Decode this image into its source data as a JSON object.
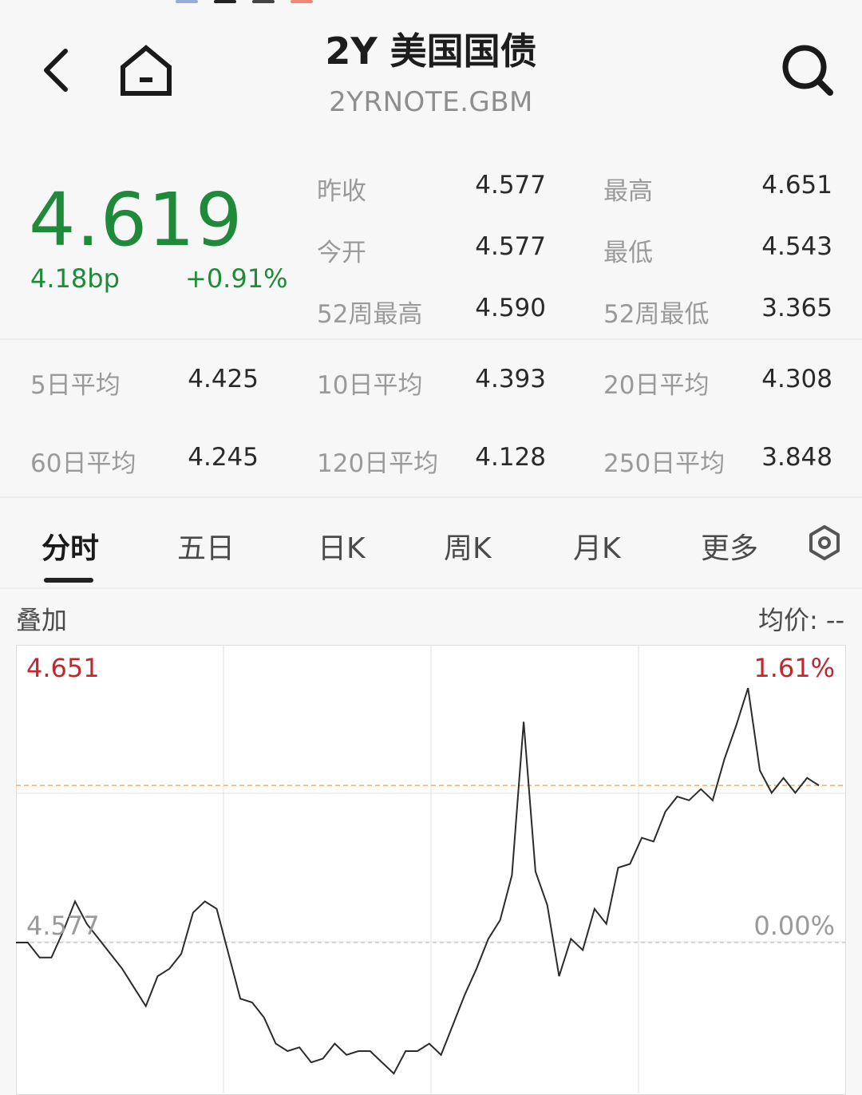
{
  "header": {
    "title": "2Y 美国国债",
    "subtitle": "2YRNOTE.GBM"
  },
  "quote": {
    "price": "4.619",
    "change_bp": "4.18bp",
    "change_pct": "+0.91%",
    "stats": [
      {
        "label": "昨收",
        "value": "4.577"
      },
      {
        "label": "最高",
        "value": "4.651"
      },
      {
        "label": "今开",
        "value": "4.577"
      },
      {
        "label": "最低",
        "value": "4.543"
      },
      {
        "label": "52周最高",
        "value": "4.590"
      },
      {
        "label": "52周最低",
        "value": "3.365"
      }
    ],
    "averages": [
      {
        "label": "5日平均",
        "value": "4.425"
      },
      {
        "label": "10日平均",
        "value": "4.393"
      },
      {
        "label": "20日平均",
        "value": "4.308"
      },
      {
        "label": "60日平均",
        "value": "4.245"
      },
      {
        "label": "120日平均",
        "value": "4.128"
      },
      {
        "label": "250日平均",
        "value": "3.848"
      }
    ]
  },
  "tabs": [
    "分时",
    "五日",
    "日K",
    "周K",
    "月K",
    "更多"
  ],
  "active_tab": "分时",
  "overlay_label": "叠加",
  "avg_price_label": "均价: --",
  "colors": {
    "up_red": "#c0282d",
    "down_green": "#1e8a3a",
    "line": "#2b2b2b",
    "ref_dashed": "#f0b070"
  },
  "icons": {
    "back": "chevron-left-icon",
    "home": "home-icon",
    "search": "search-icon",
    "settings": "settings-hexagon-icon"
  },
  "chart_data": {
    "type": "line",
    "y_max_label": "4.651",
    "y_ref_label": "4.577",
    "pct_max_label": "1.61%",
    "pct_ref_label": "0.00%",
    "ylim": [
      4.543,
      4.651
    ],
    "reference": 4.577,
    "current": 4.619,
    "grid": true,
    "values": [
      4.577,
      4.577,
      4.573,
      4.573,
      4.58,
      4.588,
      4.582,
      4.578,
      4.574,
      4.57,
      4.565,
      4.56,
      4.568,
      4.57,
      4.574,
      4.585,
      4.588,
      4.586,
      4.574,
      4.562,
      4.561,
      4.557,
      4.55,
      4.548,
      4.549,
      4.545,
      4.546,
      4.55,
      4.547,
      4.548,
      4.548,
      4.545,
      4.542,
      4.548,
      4.548,
      4.55,
      4.547,
      4.555,
      4.563,
      4.57,
      4.578,
      4.583,
      4.595,
      4.636,
      4.596,
      4.587,
      4.568,
      4.578,
      4.575,
      4.586,
      4.582,
      4.597,
      4.598,
      4.605,
      4.604,
      4.612,
      4.616,
      4.615,
      4.618,
      4.615,
      4.626,
      4.635,
      4.645,
      4.623,
      4.617,
      4.621,
      4.617,
      4.621,
      4.619
    ]
  }
}
